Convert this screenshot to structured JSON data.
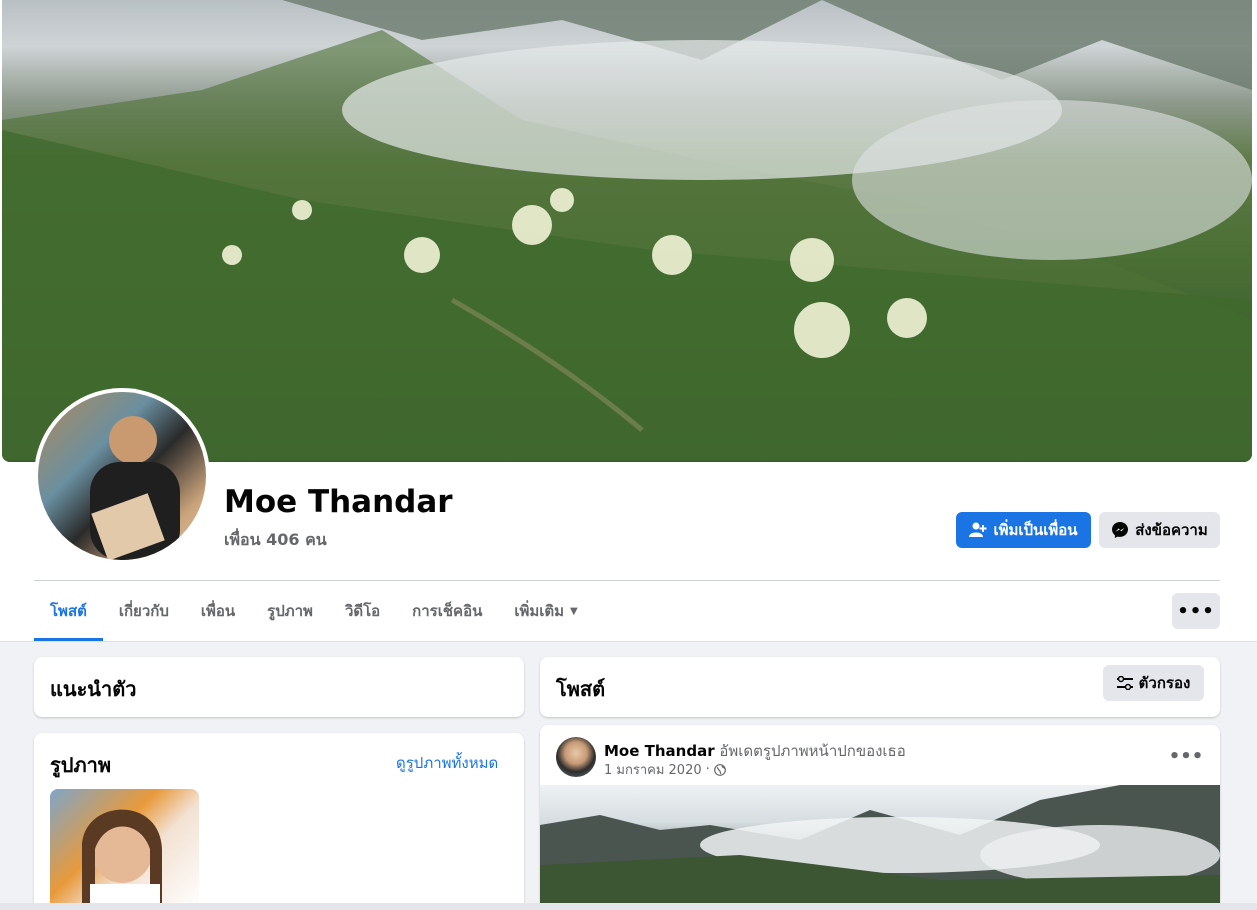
{
  "profile": {
    "name": "Moe Thandar",
    "friends_count": "เพื่อน 406 คน"
  },
  "actions": {
    "add_friend": "เพิ่มเป็นเพื่อน",
    "message": "ส่งข้อความ"
  },
  "tabs": [
    {
      "label": "โพสต์",
      "active": true
    },
    {
      "label": "เกี่ยวกับ"
    },
    {
      "label": "เพื่อน"
    },
    {
      "label": "รูปภาพ"
    },
    {
      "label": "วิดีโอ"
    },
    {
      "label": "การเช็คอิน"
    },
    {
      "label": "เพิ่มเติม"
    }
  ],
  "intro": {
    "title": "แนะนำตัว"
  },
  "photos": {
    "title": "รูปภาพ",
    "see_all": "ดูรูปภาพทั้งหมด"
  },
  "posts": {
    "title": "โพสต์",
    "filter_label": "ตัวกรอง"
  },
  "post": {
    "author": "Moe Thandar",
    "action": "อัพเดตรูปภาพหน้าปกของเธอ",
    "date": "1 มกราคม 2020",
    "separator": "·"
  },
  "colors": {
    "accent": "#1b74e4",
    "button_gray": "#e4e6eb",
    "bg": "#f0f2f5"
  },
  "icons": [
    "person-add-icon",
    "messenger-icon",
    "caret-down-icon",
    "more-icon",
    "filter-icon",
    "globe-icon"
  ]
}
